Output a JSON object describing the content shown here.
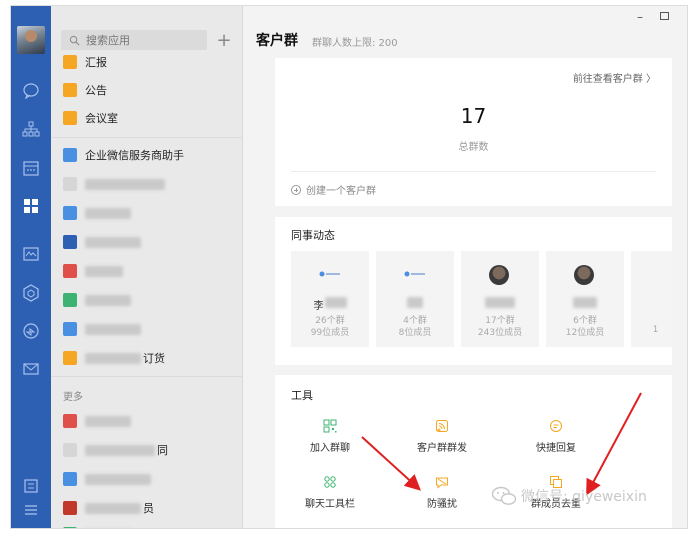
{
  "rail": {
    "icons": [
      "avatar",
      "chat-icon",
      "org-icon",
      "calendar-icon",
      "workbench-icon",
      "doc-icon",
      "drive-icon",
      "meeting-icon",
      "mail-icon",
      "settings-icon",
      "menu-icon"
    ]
  },
  "sidebar": {
    "search_placeholder": "搜索应用",
    "add_label": "+",
    "items": [
      {
        "label": "汇报",
        "color": "#f5a623"
      },
      {
        "label": "公告",
        "color": "#f5a623"
      },
      {
        "label": "会议室",
        "color": "#f5a623"
      },
      {
        "label": "企业微信服务商助手",
        "color": "#4a90e2"
      },
      {
        "label": "订货",
        "color": "#f5a623"
      }
    ],
    "more_label": "更多",
    "partial_labels": [
      "同",
      "员"
    ]
  },
  "main": {
    "title": "客户群",
    "subtitle": "群聊人数上限: 200",
    "window": {
      "minimize": "–"
    },
    "groups_card": {
      "link": "前往查看客户群  〉",
      "count": "17",
      "count_label": "总群数",
      "create_label": "创建一个客户群"
    },
    "colleagues_card": {
      "heading": "同事动态",
      "columns": [
        {
          "name": "李",
          "groups": "26个群",
          "members": "99位成员",
          "avatar": "logo"
        },
        {
          "name": "",
          "groups": "4个群",
          "members": "8位成员",
          "avatar": "logo"
        },
        {
          "name": "",
          "groups": "17个群",
          "members": "243位成员",
          "avatar": "face"
        },
        {
          "name": "",
          "groups": "6个群",
          "members": "12位成员",
          "avatar": "face"
        },
        {
          "name": "",
          "groups": "",
          "members": "1",
          "avatar": "none"
        }
      ]
    },
    "tools_card": {
      "heading": "工具",
      "tools": [
        {
          "label": "加入群聊",
          "icon": "qr-icon"
        },
        {
          "label": "客户群群发",
          "icon": "broadcast-icon"
        },
        {
          "label": "快捷回复",
          "icon": "reply-icon"
        },
        {
          "label": "聊天工具栏",
          "icon": "toolbar-icon"
        },
        {
          "label": "防骚扰",
          "icon": "anti-harass-icon"
        },
        {
          "label": "群成员去重",
          "icon": "dedupe-icon"
        }
      ]
    }
  },
  "watermark": {
    "text": "微信号: qiyeweixin"
  },
  "colors": {
    "rail": "#2d5fb3",
    "accent_green": "#3cb371",
    "accent_orange": "#f5a623",
    "arrow": "#e02020"
  }
}
